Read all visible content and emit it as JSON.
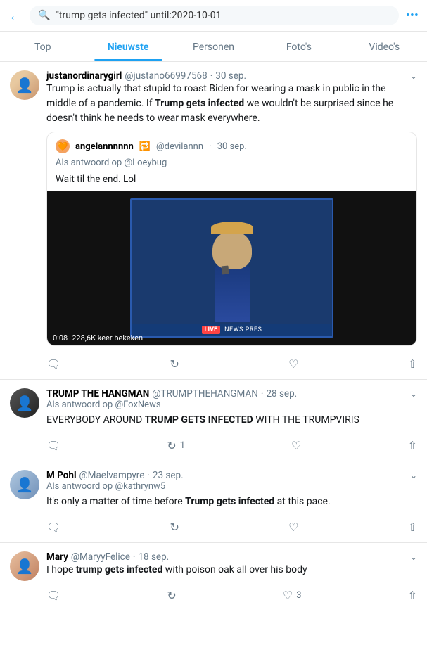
{
  "topbar": {
    "back_label": "←",
    "search_query": "\"trump gets infected\" until:2020-10-01",
    "more_label": "•••"
  },
  "nav": {
    "tabs": [
      {
        "id": "top",
        "label": "Top",
        "active": false
      },
      {
        "id": "nieuwste",
        "label": "Nieuwste",
        "active": true
      },
      {
        "id": "personen",
        "label": "Personen",
        "active": false
      },
      {
        "id": "fotos",
        "label": "Foto's",
        "active": false
      },
      {
        "id": "videos",
        "label": "Video's",
        "active": false
      }
    ]
  },
  "tweets": [
    {
      "id": "tweet1",
      "username": "justanordinarygirl",
      "handle": "@justano66997568",
      "date": "30 sep.",
      "body_before": "Trump is actually that stupid to roast Biden for wearing a mask in public in the middle of a pandemic. If ",
      "body_bold": "Trump gets infected",
      "body_after": " we wouldn't be surprised since he doesn't think he needs to wear mask everywhere.",
      "has_quote": true,
      "quote": {
        "avatar_emoji": "🧡",
        "username": "angelannnnnn",
        "extra": "🔁",
        "handle": "@devilannn",
        "date": "30 sep.",
        "reply_to": "Als antwoord op @Loeybug",
        "body": "Wait til the end. Lol"
      },
      "has_video": true,
      "video": {
        "duration": "0:08",
        "views": "228,6K keer bekeken",
        "news_badge": "LIVE",
        "news_text": "NEWS PRES"
      },
      "actions": {
        "reply": "",
        "retweet": "",
        "like": "",
        "share": ""
      }
    },
    {
      "id": "tweet2",
      "username": "TRUMP THE HANGMAN",
      "handle": "@TRUMPTHEHANGMAN",
      "date": "28 sep.",
      "reply_to": "Als antwoord op @FoxNews",
      "body_before": "EVERYBODY AROUND ",
      "body_bold": "TRUMP GETS INFECTED",
      "body_after": " WITH THE TRUMPVIRIS",
      "actions": {
        "reply": "",
        "retweet": "1",
        "like": "",
        "share": ""
      }
    },
    {
      "id": "tweet3",
      "username": "M Pohl",
      "handle": "@Maelvampyre",
      "date": "23 sep.",
      "reply_to": "Als antwoord op @kathrynw5",
      "body_before": "It's only a matter of time before ",
      "body_bold": "Trump gets infected",
      "body_after": " at this pace.",
      "actions": {
        "reply": "",
        "retweet": "",
        "like": "",
        "share": ""
      }
    },
    {
      "id": "tweet4",
      "username": "Mary",
      "handle": "@MaryyFelice",
      "date": "18 sep.",
      "body_before": "I hope ",
      "body_bold": "trump gets infected",
      "body_after": " with poison oak all over his body",
      "actions": {
        "reply": "",
        "retweet": "",
        "like": "3",
        "share": ""
      }
    }
  ]
}
